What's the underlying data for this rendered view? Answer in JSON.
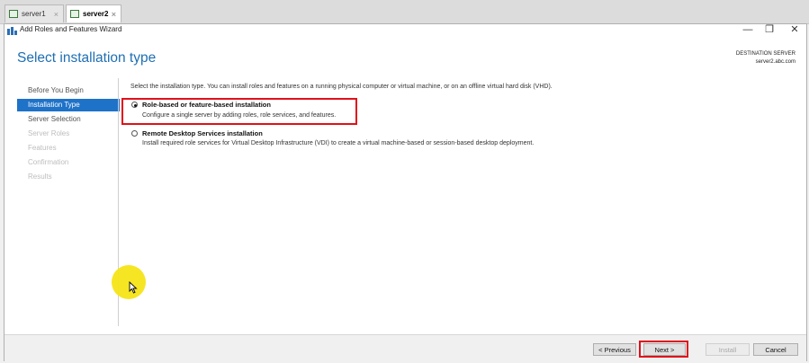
{
  "tabs": [
    {
      "label": "server1",
      "close": "×"
    },
    {
      "label": "server2",
      "close": "×"
    }
  ],
  "window": {
    "title": "Add Roles and Features Wizard",
    "minimize": "—",
    "restore": "❐",
    "close": "✕"
  },
  "header": {
    "title": "Select installation type",
    "destination_label": "DESTINATION SERVER",
    "destination_value": "server2.abc.com"
  },
  "nav": [
    {
      "label": "Before You Begin",
      "state": "normal"
    },
    {
      "label": "Installation Type",
      "state": "active"
    },
    {
      "label": "Server Selection",
      "state": "normal"
    },
    {
      "label": "Server Roles",
      "state": "disabled"
    },
    {
      "label": "Features",
      "state": "disabled"
    },
    {
      "label": "Confirmation",
      "state": "disabled"
    },
    {
      "label": "Results",
      "state": "disabled"
    }
  ],
  "content": {
    "intro": "Select the installation type. You can install roles and features on a running physical computer or virtual machine, or on an offline virtual hard disk (VHD).",
    "options": [
      {
        "title": "Role-based or feature-based installation",
        "description": "Configure a single server by adding roles, role services, and features.",
        "selected": true
      },
      {
        "title": "Remote Desktop Services installation",
        "description": "Install required role services for Virtual Desktop Infrastructure (VDI) to create a virtual machine-based or session-based desktop deployment.",
        "selected": false
      }
    ]
  },
  "footer": {
    "previous": "< Previous",
    "next": "Next >",
    "install": "Install",
    "cancel": "Cancel"
  },
  "colors": {
    "accent": "#1e72c8",
    "title_blue": "#1e6fb3",
    "highlight_red": "#e0101a",
    "cursor_highlight": "#f5e416"
  }
}
